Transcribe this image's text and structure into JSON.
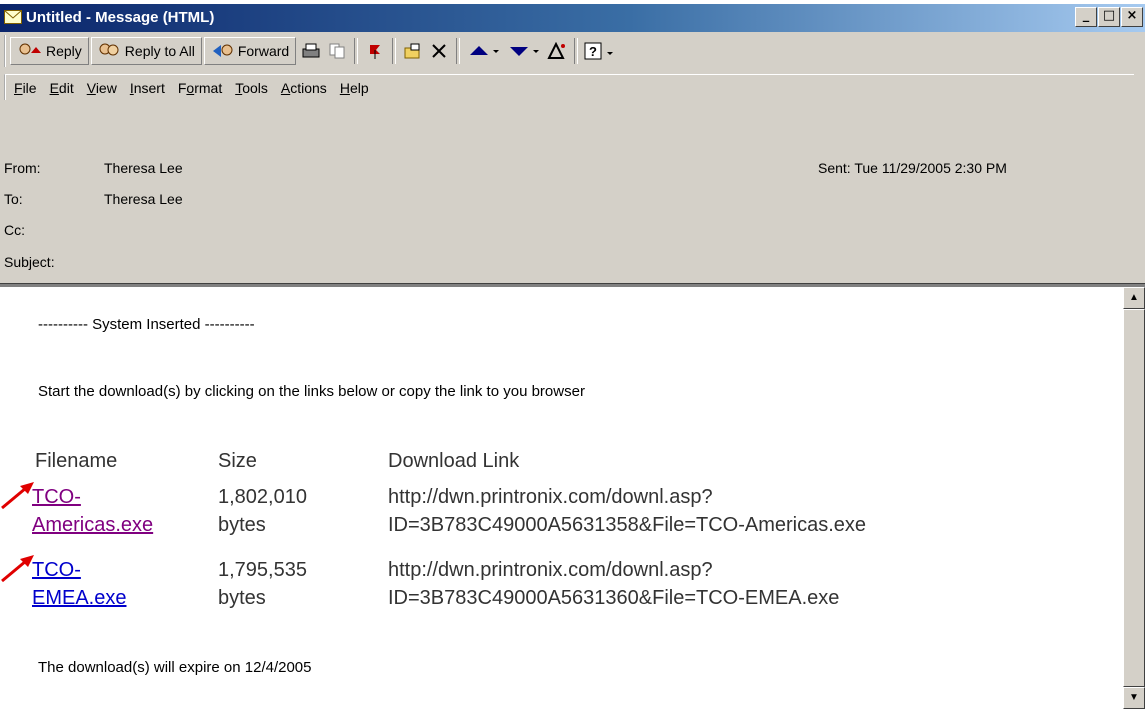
{
  "window": {
    "title": "Untitled - Message (HTML)",
    "controls": [
      "_",
      "□",
      "×"
    ]
  },
  "toolbar": {
    "reply_label": "Reply",
    "reply_all_label": "Reply to All",
    "forward_label": "Forward"
  },
  "menu": {
    "items": [
      {
        "hot": "F",
        "rest": "ile"
      },
      {
        "hot": "E",
        "rest": "dit"
      },
      {
        "hot": "V",
        "rest": "iew"
      },
      {
        "hot": "I",
        "rest": "nsert"
      },
      {
        "pre": "F",
        "hot": "o",
        "rest": "rmat"
      },
      {
        "hot": "T",
        "rest": "ools"
      },
      {
        "hot": "A",
        "rest": "ctions"
      },
      {
        "hot": "H",
        "rest": "elp"
      }
    ]
  },
  "header": {
    "from_label": "From:",
    "from_value": "Theresa Lee",
    "to_label": "To:",
    "to_value": "Theresa Lee",
    "cc_label": "Cc:",
    "subject_label": "Subject:",
    "sent_label": "Sent:",
    "sent_value": "Tue 11/29/2005 2:30 PM"
  },
  "body": {
    "system_line": "---------- System Inserted ----------",
    "instruction": "Start the download(s) by clicking on the links below or copy the link to you browser",
    "columns": [
      "Filename",
      "Size",
      "Download Link"
    ],
    "rows": [
      {
        "file_line1": "TCO-",
        "file_line2": "Americas.exe",
        "size_line1": "1,802,010",
        "size_line2": "bytes",
        "link_line1": "http://dwn.printronix.com/downl.asp?",
        "link_line2": "ID=3B783C49000A5631358&File=TCO-Americas.exe"
      },
      {
        "file_line1": "TCO-",
        "file_line2": "EMEA.exe",
        "size_line1": "1,795,535",
        "size_line2": "bytes",
        "link_line1": "http://dwn.printronix.com/downl.asp?",
        "link_line2": "ID=3B783C49000A5631360&File=TCO-EMEA.exe"
      }
    ],
    "expire_line": "The download(s) will expire on 12/4/2005"
  }
}
